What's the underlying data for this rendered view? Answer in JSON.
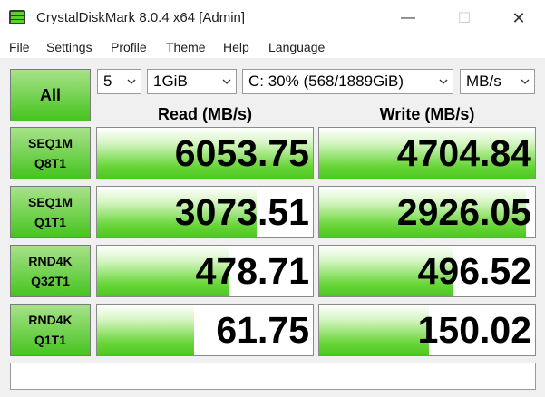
{
  "window": {
    "title": "CrystalDiskMark 8.0.4 x64 [Admin]",
    "min_glyph": "—",
    "max_glyph": "☐",
    "close_glyph": "✕"
  },
  "menu": [
    "File",
    "Settings",
    "Profile",
    "Theme",
    "Help",
    "Language"
  ],
  "controls": {
    "all_label": "All",
    "count": "5",
    "size": "1GiB",
    "drive": "C: 30% (568/1889GiB)",
    "unit": "MB/s"
  },
  "headers": {
    "read": "Read (MB/s)",
    "write": "Write (MB/s)"
  },
  "tests": [
    {
      "line1": "SEQ1M",
      "line2": "Q8T1",
      "read": "6053.75",
      "write": "4704.84",
      "read_fill": 1.0,
      "write_fill": 1.0
    },
    {
      "line1": "SEQ1M",
      "line2": "Q1T1",
      "read": "3073.51",
      "write": "2926.05",
      "read_fill": 0.74,
      "write_fill": 0.96
    },
    {
      "line1": "RND4K",
      "line2": "Q32T1",
      "read": "478.71",
      "write": "496.52",
      "read_fill": 0.61,
      "write_fill": 0.62
    },
    {
      "line1": "RND4K",
      "line2": "Q1T1",
      "read": "61.75",
      "write": "150.02",
      "read_fill": 0.45,
      "write_fill": 0.51
    }
  ],
  "comment": "",
  "colors": {
    "accent_green": "#45c41e",
    "bar_green": "#6ad63a"
  },
  "icons": [
    "app-icon",
    "chevron-down-icon"
  ]
}
